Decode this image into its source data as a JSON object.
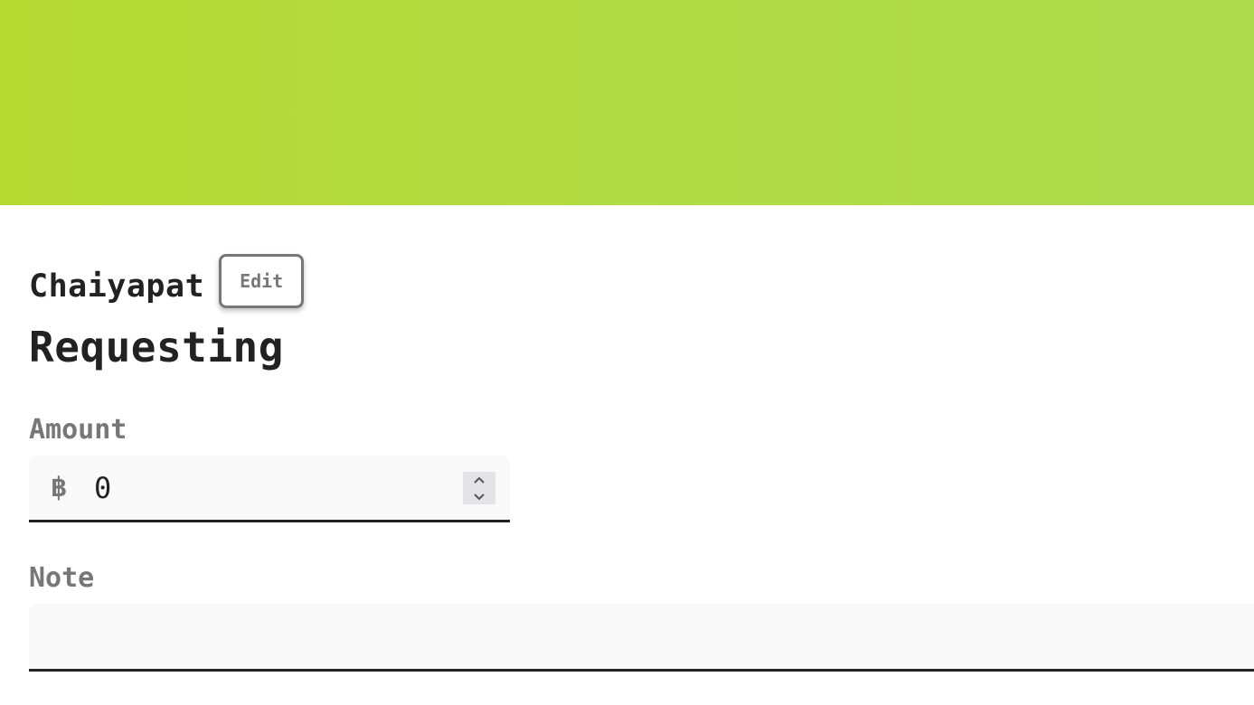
{
  "banner": {
    "color": "#b4da3a"
  },
  "profile": {
    "name": "Chaiyapat",
    "edit_label": "Edit"
  },
  "page": {
    "heading": "Requesting"
  },
  "amount": {
    "label": "Amount",
    "currency_symbol": "฿",
    "value": "0"
  },
  "note": {
    "label": "Note",
    "value": "",
    "placeholder": ""
  },
  "icons": {
    "stepper_up": "chevron-up-icon",
    "stepper_down": "chevron-down-icon"
  }
}
